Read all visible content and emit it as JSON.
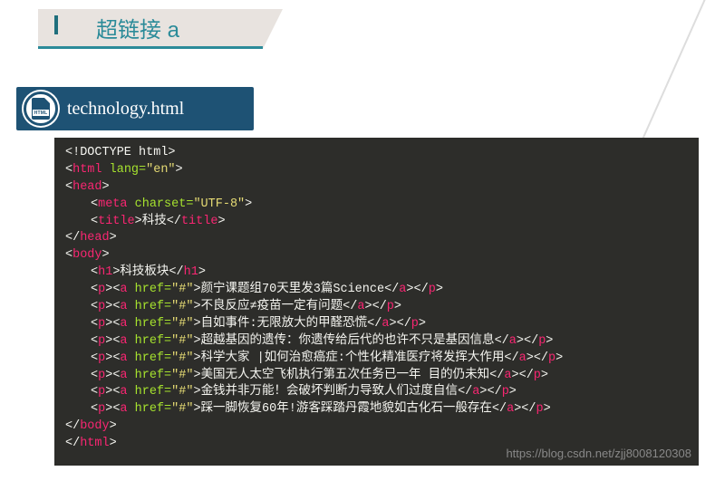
{
  "header": {
    "title": "超链接 a"
  },
  "file": {
    "icon_label": "HTML",
    "name": "technology.html"
  },
  "code": {
    "doctype": "<!DOCTYPE html>",
    "html_open_tag": "html",
    "html_open_attr": " lang=",
    "html_open_val": "\"en\"",
    "head_open": "head",
    "meta_tag": "meta",
    "meta_attr": " charset=",
    "meta_val": "\"UTF-8\"",
    "title_tag": "title",
    "title_text": "科技",
    "head_close": "head",
    "body_open": "body",
    "h1_tag": "h1",
    "h1_text": "科技板块",
    "p_tag": "p",
    "a_tag": "a",
    "href_attr": " href=",
    "href_val": "\"#\"",
    "links": [
      "颜宁课题组70天里发3篇Science",
      "不良反应≠疫苗一定有问题",
      "自如事件:无限放大的甲醛恐慌",
      "超越基因的遗传：你遗传给后代的也许不只是基因信息",
      "科学大家 |如何治愈癌症:个性化精准医疗将发挥大作用",
      "美国无人太空飞机执行第五次任务已一年 目的仍未知",
      "金钱并非万能！会破坏判断力导致人们过度自信",
      "踩一脚恢复60年!游客踩踏丹霞地貌如古化石一般存在"
    ],
    "body_close": "body",
    "html_close": "html"
  },
  "watermark": "https://blog.csdn.net/zjj8008120308"
}
